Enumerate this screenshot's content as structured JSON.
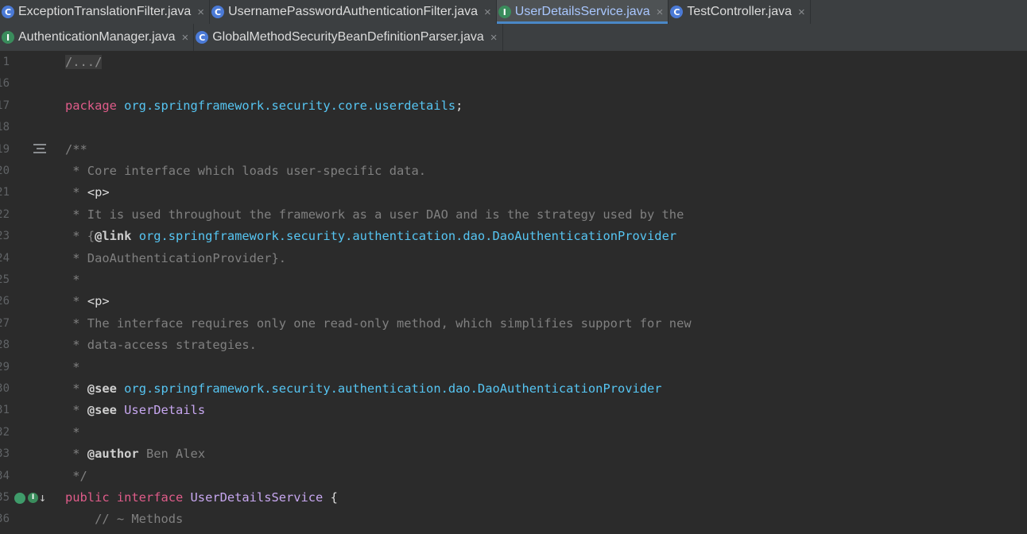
{
  "tabs_row1": [
    {
      "label": "ExceptionTranslationFilter.java",
      "type": "C",
      "active": false
    },
    {
      "label": "UsernamePasswordAuthenticationFilter.java",
      "type": "C",
      "active": false
    },
    {
      "label": "UserDetailsService.java",
      "type": "I",
      "active": true
    },
    {
      "label": "TestController.java",
      "type": "C",
      "active": false
    }
  ],
  "tabs_row2": [
    {
      "label": "AuthenticationManager.java",
      "type": "I",
      "active": false
    },
    {
      "label": "GlobalMethodSecurityBeanDefinitionParser.java",
      "type": "C",
      "active": false
    }
  ],
  "close_glyph": "×",
  "editor": {
    "lines": [
      {
        "num": "1",
        "parts": [
          {
            "t": "fold",
            "v": "/.../"
          }
        ]
      },
      {
        "num": "16",
        "parts": []
      },
      {
        "num": "17",
        "parts": [
          {
            "t": "kw",
            "v": "package "
          },
          {
            "t": "pkg",
            "v": "org.springframework.security.core.userdetails"
          },
          {
            "t": "plain",
            "v": ";"
          }
        ]
      },
      {
        "num": "18",
        "parts": []
      },
      {
        "num": "19",
        "parts": [
          {
            "t": "cm",
            "v": "/**"
          }
        ]
      },
      {
        "num": "20",
        "parts": [
          {
            "t": "cm",
            "v": " * Core interface which loads user-specific data."
          }
        ]
      },
      {
        "num": "21",
        "parts": [
          {
            "t": "cm",
            "v": " * "
          },
          {
            "t": "tag",
            "v": "<p>"
          }
        ]
      },
      {
        "num": "22",
        "parts": [
          {
            "t": "cm",
            "v": " * It is used throughout the framework as a user DAO and is the strategy used by the"
          }
        ]
      },
      {
        "num": "23",
        "parts": [
          {
            "t": "cm",
            "v": " * {"
          },
          {
            "t": "ann",
            "v": "@link "
          },
          {
            "t": "link",
            "v": "org.springframework.security.authentication.dao.DaoAuthenticationProvider"
          }
        ]
      },
      {
        "num": "24",
        "parts": [
          {
            "t": "cm",
            "v": " * DaoAuthenticationProvider}."
          }
        ]
      },
      {
        "num": "25",
        "parts": [
          {
            "t": "cm",
            "v": " *"
          }
        ]
      },
      {
        "num": "26",
        "parts": [
          {
            "t": "cm",
            "v": " * "
          },
          {
            "t": "tag",
            "v": "<p>"
          }
        ]
      },
      {
        "num": "27",
        "parts": [
          {
            "t": "cm",
            "v": " * The interface requires only one read-only method, which simplifies support for new"
          }
        ]
      },
      {
        "num": "28",
        "parts": [
          {
            "t": "cm",
            "v": " * data-access strategies."
          }
        ]
      },
      {
        "num": "29",
        "parts": [
          {
            "t": "cm",
            "v": " *"
          }
        ]
      },
      {
        "num": "30",
        "parts": [
          {
            "t": "cm",
            "v": " * "
          },
          {
            "t": "ann",
            "v": "@see "
          },
          {
            "t": "link",
            "v": "org.springframework.security.authentication.dao.DaoAuthenticationProvider"
          }
        ]
      },
      {
        "num": "31",
        "parts": [
          {
            "t": "cm",
            "v": " * "
          },
          {
            "t": "ann",
            "v": "@see "
          },
          {
            "t": "iface",
            "v": "UserDetails"
          }
        ]
      },
      {
        "num": "32",
        "parts": [
          {
            "t": "cm",
            "v": " *"
          }
        ]
      },
      {
        "num": "33",
        "parts": [
          {
            "t": "cm",
            "v": " * "
          },
          {
            "t": "ann",
            "v": "@author "
          },
          {
            "t": "cm",
            "v": "Ben Alex"
          }
        ]
      },
      {
        "num": "34",
        "parts": [
          {
            "t": "cm",
            "v": " */"
          }
        ]
      },
      {
        "num": "35",
        "parts": [
          {
            "t": "kw",
            "v": "public interface "
          },
          {
            "t": "iface",
            "v": "UserDetailsService "
          },
          {
            "t": "plain",
            "v": "{"
          }
        ]
      },
      {
        "num": "36",
        "parts": [
          {
            "t": "cm",
            "v": "    // ~ Methods"
          }
        ]
      }
    ]
  },
  "gutter": {
    "doc_icon": "javadoc-render-icon",
    "impl_icon": "implemented-icon",
    "impl_arrow": "↓",
    "impl_badge": "I"
  }
}
